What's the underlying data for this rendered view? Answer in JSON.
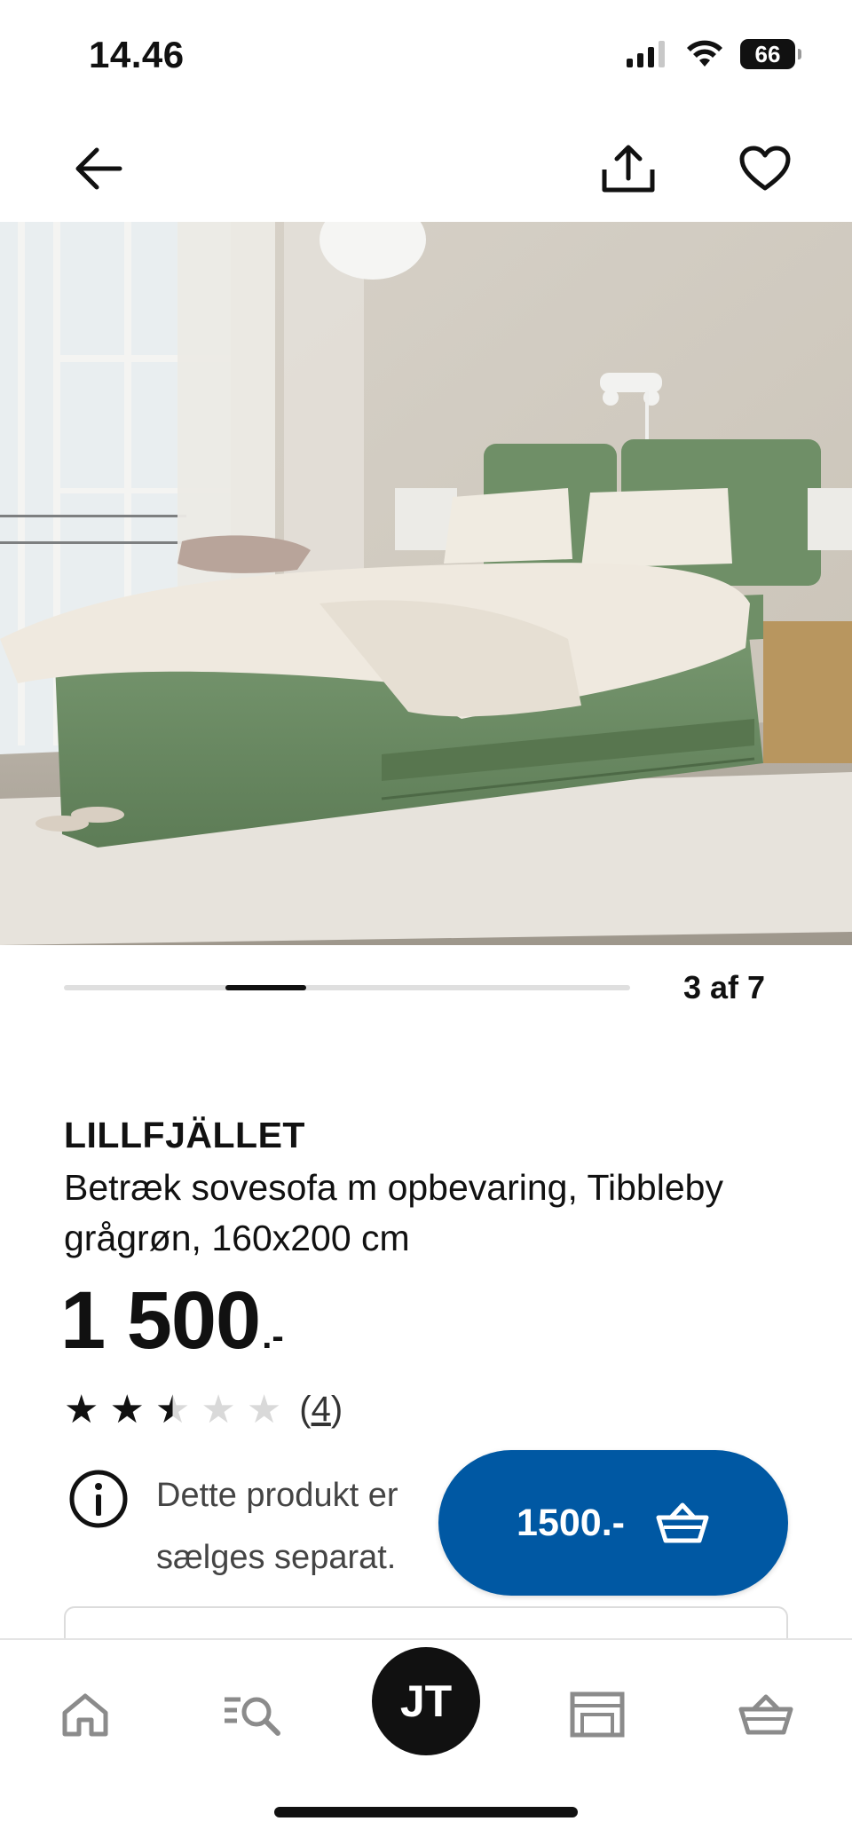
{
  "status_bar": {
    "time": "14.46",
    "battery": "66"
  },
  "carousel": {
    "counter": "3 af 7",
    "current": 3,
    "total": 7
  },
  "product": {
    "brand": "LILLFJÄLLET",
    "description": "Betræk sovesofa m opbevaring, Tibbleby grågrøn, 160x200 cm",
    "price_int": "1 500",
    "price_dec": ".-"
  },
  "rating": {
    "value": 2.5,
    "max": 5,
    "count_open": "(",
    "count": "4",
    "count_close": ")"
  },
  "info": {
    "text_visible_line1": "Dette produkt er",
    "text_visible_line2": "sælges separat."
  },
  "cart_button": {
    "label": "1500.-"
  },
  "bottom_nav": {
    "avatar_initials": "JT"
  },
  "icons": {
    "back": "arrow-left-icon",
    "share": "share-icon",
    "favorite": "heart-icon",
    "info": "info-icon",
    "cart": "basket-icon",
    "home": "home-icon",
    "search": "search-list-icon",
    "store": "store-icon",
    "basket": "basket-icon"
  },
  "colors": {
    "accent": "#0058a3",
    "text": "#111111",
    "muted": "#444444"
  }
}
